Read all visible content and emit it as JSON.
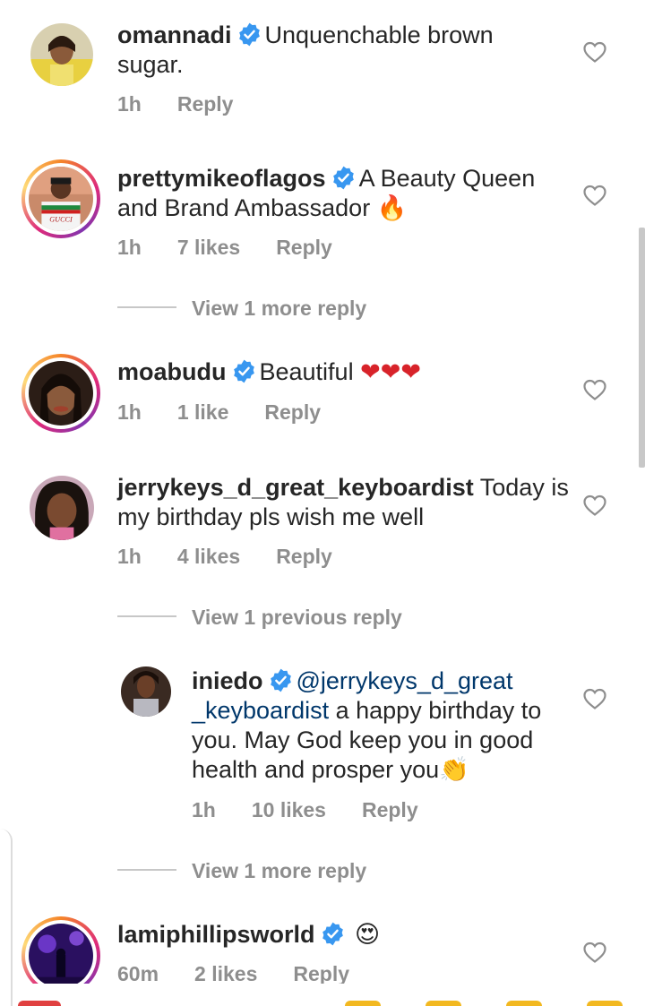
{
  "comments": [
    {
      "username": "omannadi",
      "text_line1": "Unquenchable brown",
      "text_line2": "sugar.",
      "time": "1h",
      "reply": "Reply"
    },
    {
      "username": "prettymikeoflagos",
      "text_line1": "A Beauty Queen",
      "text_line2": "and Brand Ambassador",
      "emoji": "🔥",
      "time": "1h",
      "likes": "7 likes",
      "reply": "Reply",
      "view_more": "View 1 more reply",
      "avatar_shirt_text": "GUCCI"
    },
    {
      "username": "moabudu",
      "text": "Beautiful",
      "emoji": "❤❤❤",
      "time": "1h",
      "likes": "1 like",
      "reply": "Reply"
    },
    {
      "username": "jerrykeys_d_great_keyboardist",
      "text_line1": "Today is",
      "text_line2": "my birthday pls wish me well",
      "time": "1h",
      "likes": "4 likes",
      "reply": "Reply",
      "view_previous": "View 1 previous reply"
    },
    {
      "username": "iniedo",
      "mention_line1": "@jerrykeys_d_great",
      "mention_line2": "_keyboardist",
      "text_line2": "a happy birthday to",
      "text_line3": "you. May God keep you in good",
      "text_line4": "health and prosper you",
      "emoji": "👏",
      "time": "1h",
      "likes": "10 likes",
      "reply": "Reply",
      "view_more": "View 1 more reply"
    },
    {
      "username": "lamiphillipsworld",
      "emoji": "😍",
      "time": "60m",
      "likes": "2 likes",
      "reply": "Reply"
    }
  ],
  "colors": {
    "verified": "#3897f0",
    "heart_outline": "#8e8e8e",
    "meta_text": "#8e8e8e",
    "story_ring": [
      "#f58529",
      "#dd2a7b",
      "#8134af"
    ]
  },
  "icons": [
    "verified-badge-icon",
    "heart-outline-icon"
  ]
}
